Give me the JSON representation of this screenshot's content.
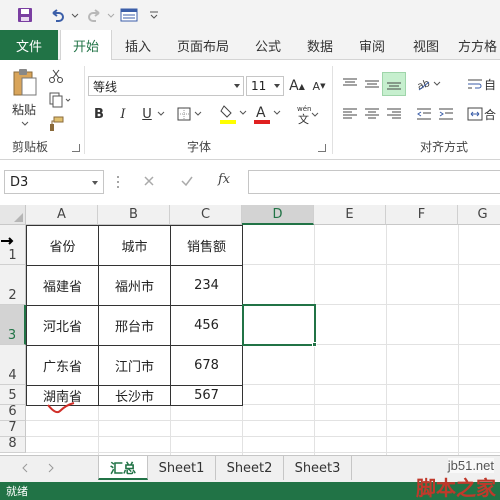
{
  "ribbon_tabs": [
    "文件",
    "开始",
    "插入",
    "页面布局",
    "公式",
    "数据",
    "审阅",
    "视图",
    "方方格"
  ],
  "ribbon": {
    "paste_label": "粘贴",
    "clipboard_group": "剪贴板",
    "font_name": "等线",
    "font_size": "11",
    "font_group": "字体",
    "align_group": "对齐方式",
    "bold": "B",
    "italic": "I",
    "underline": "U",
    "grow_font": "A",
    "shrink_font": "A",
    "auto_label": "自",
    "merge_label": "合"
  },
  "formula_bar": {
    "name_box": "D3",
    "fx": "fx"
  },
  "columns": [
    "A",
    "B",
    "C",
    "D",
    "E",
    "F",
    "G"
  ],
  "rows": [
    "1",
    "2",
    "3",
    "4",
    "5",
    "6",
    "7",
    "8"
  ],
  "table": [
    [
      "省份",
      "城市",
      "销售额"
    ],
    [
      "福建省",
      "福州市",
      "234"
    ],
    [
      "河北省",
      "邢台市",
      "456"
    ],
    [
      "广东省",
      "江门市",
      "678"
    ],
    [
      "湖南省",
      "长沙市",
      "567"
    ]
  ],
  "sheets": [
    "汇总",
    "Sheet1",
    "Sheet2",
    "Sheet3"
  ],
  "active_sheet": "汇总",
  "status": "就绪",
  "watermark": {
    "site": "jb51.net",
    "brand": "脚本之家"
  },
  "colors": {
    "accent": "#217346"
  }
}
